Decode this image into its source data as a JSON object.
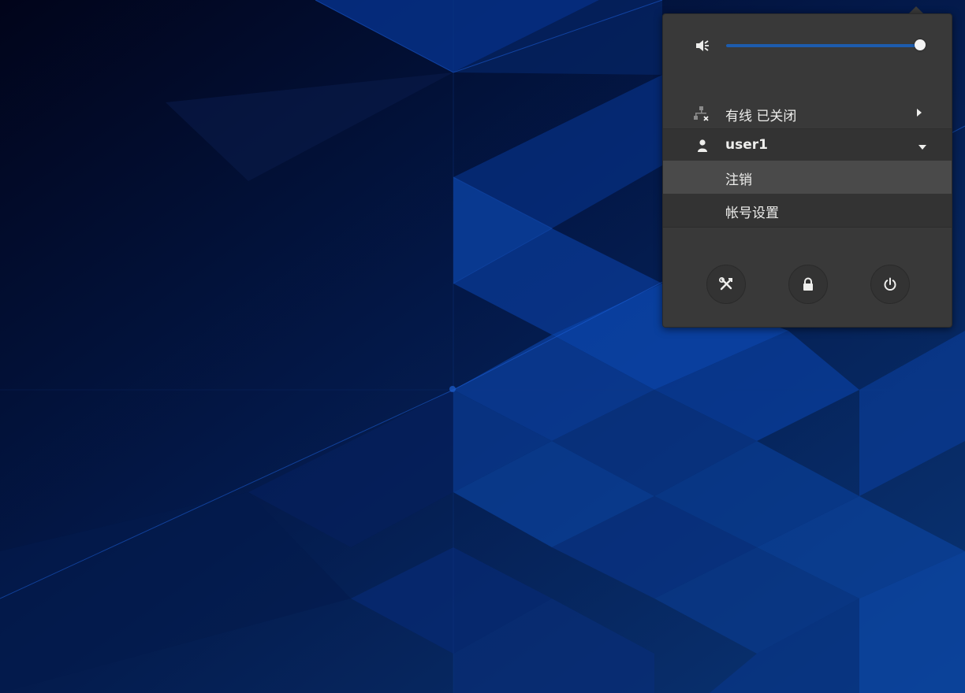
{
  "colors": {
    "wallpaper_dark": "#020618",
    "wallpaper_blue": "#0a3d8f",
    "menu_bg": "#393939",
    "accent": "#1d5cad",
    "text": "#eeeeec"
  },
  "system_menu": {
    "volume": {
      "icon": "speaker-muted-icon",
      "level": 1.0
    },
    "wired": {
      "icon": "network-wired-disconnected-icon",
      "label": "有线 已关闭",
      "chevron": "chevron-right-icon"
    },
    "user": {
      "icon": "avatar-icon",
      "label": "user1",
      "chevron": "chevron-down-icon",
      "submenu": [
        {
          "label": "注销"
        },
        {
          "label": "帐号设置"
        }
      ]
    },
    "actions": [
      {
        "name": "settings",
        "icon": "settings-tools-icon"
      },
      {
        "name": "lock",
        "icon": "lock-icon"
      },
      {
        "name": "power",
        "icon": "power-icon"
      }
    ]
  }
}
